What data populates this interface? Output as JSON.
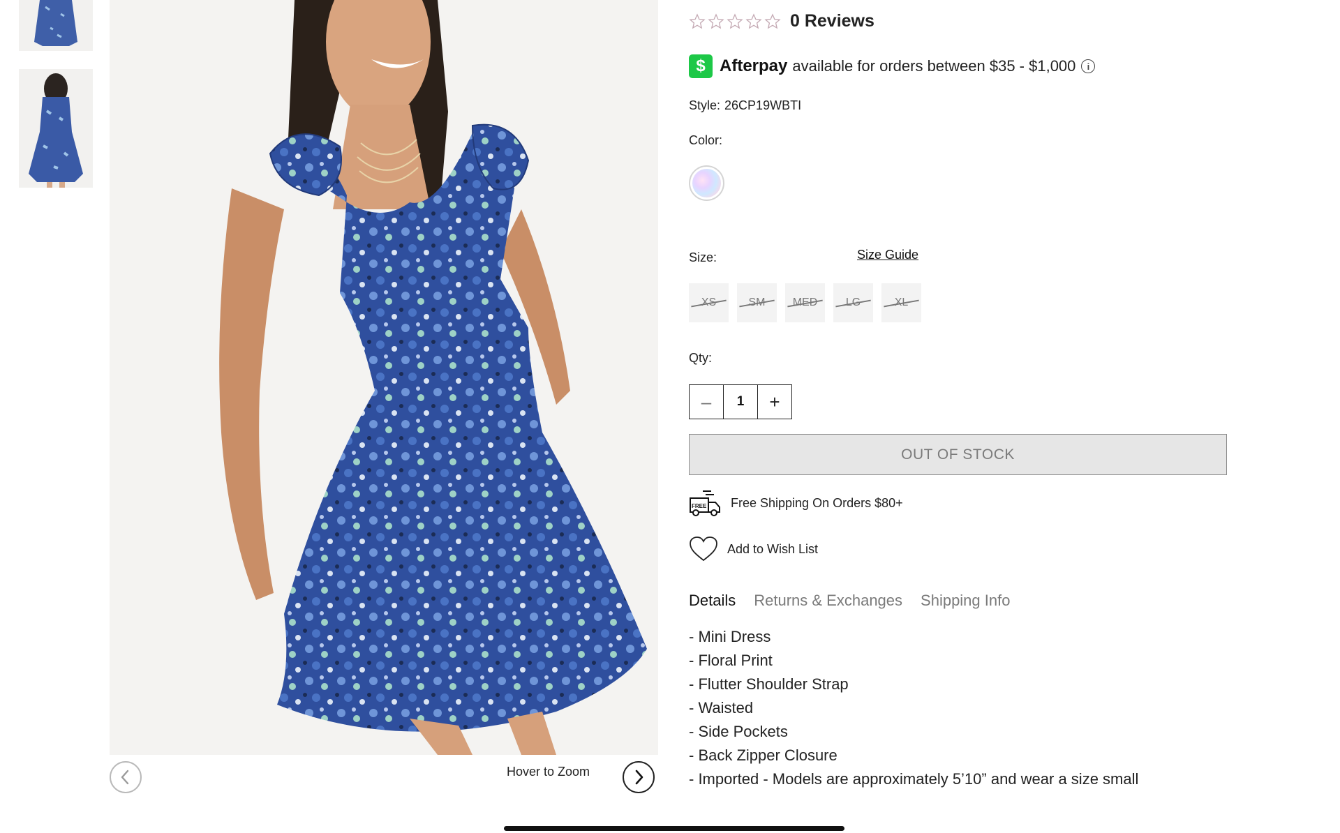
{
  "reviews": {
    "rating": 0,
    "max_rating": 5,
    "count_label": "0 Reviews"
  },
  "afterpay": {
    "logo_glyph": "$",
    "brand": "Afterpay",
    "text": "available for orders between $35 - $1,000",
    "info_glyph": "i",
    "brand_color": "#1dc847"
  },
  "product": {
    "style_label": "Style:",
    "style_value": "26CP19WBTI",
    "color_label": "Color:",
    "size_label": "Size:",
    "size_guide": "Size Guide",
    "sizes": [
      "XS",
      "SM",
      "MED",
      "LG",
      "XL"
    ],
    "sizes_available": false,
    "qty_label": "Qty:",
    "qty_value": "1",
    "qty_minus": "–",
    "qty_plus": "+",
    "stock_button": "OUT OF STOCK"
  },
  "shipping": {
    "icon": "free-shipping-truck-icon",
    "badge": "FREE",
    "text": "Free Shipping On Orders $80+"
  },
  "wishlist": {
    "icon": "heart-icon",
    "text": "Add to Wish List"
  },
  "tabs": [
    {
      "label": "Details",
      "active": true
    },
    {
      "label": "Returns & Exchanges",
      "active": false
    },
    {
      "label": "Shipping Info",
      "active": false
    }
  ],
  "details": [
    "- Mini Dress",
    "- Floral Print",
    "- Flutter Shoulder Strap",
    "- Waisted",
    "- Side Pockets",
    "- Back Zipper Closure",
    "- Imported - Models are approximately 5’10” and wear a size small"
  ],
  "gallery": {
    "hover_label": "Hover to Zoom",
    "thumbnail_count": 2
  }
}
